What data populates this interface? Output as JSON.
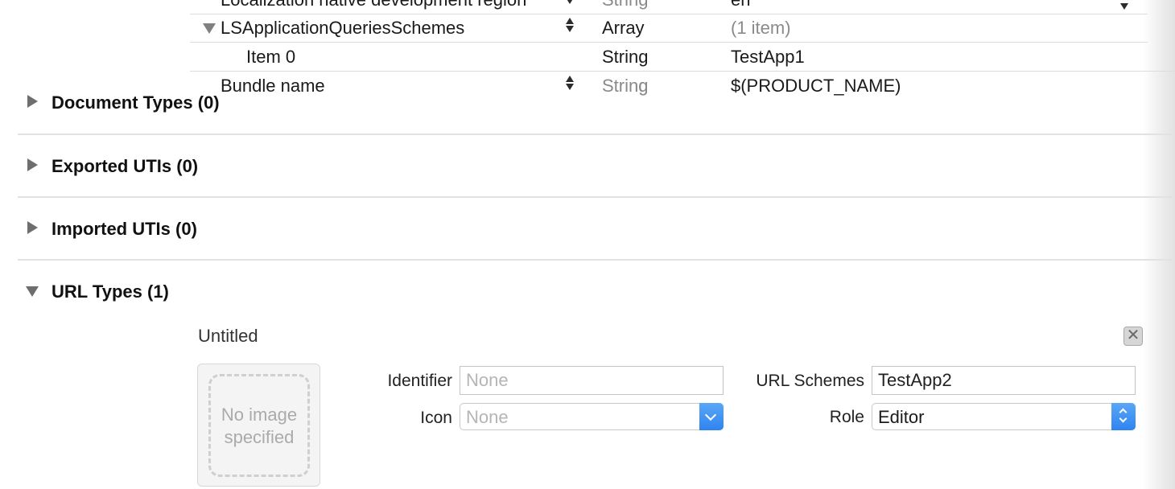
{
  "plist": {
    "rows": [
      {
        "key": "Localization native development region",
        "type": "String",
        "value": "en"
      },
      {
        "key": "LSApplicationQueriesSchemes",
        "type": "Array",
        "value": "(1 item)"
      },
      {
        "key": "Item 0",
        "type": "String",
        "value": "TestApp1"
      },
      {
        "key": "Bundle name",
        "type": "String",
        "value": "$(PRODUCT_NAME)"
      }
    ]
  },
  "sections": {
    "document_types": "Document Types (0)",
    "exported_utis": "Exported UTIs (0)",
    "imported_utis": "Imported UTIs (0)",
    "url_types": "URL Types (1)"
  },
  "url_type": {
    "name": "Untitled",
    "remove_icon": "close-icon",
    "image_placeholder": "No image specified",
    "identifier_label": "Identifier",
    "identifier_placeholder": "None",
    "icon_label": "Icon",
    "icon_value": "None",
    "url_schemes_label": "URL Schemes",
    "url_schemes_value": "TestApp2",
    "role_label": "Role",
    "role_value": "Editor"
  },
  "colors": {
    "popup_accent": "#3b8ff3",
    "separator": "#e2e2e2"
  }
}
